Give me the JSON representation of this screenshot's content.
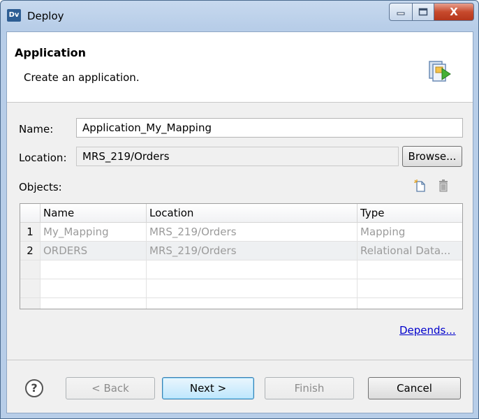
{
  "window": {
    "app_icon": "Dv",
    "title": "Deploy",
    "controls": {
      "minimize": "—",
      "maximize": "☐",
      "close": "X"
    }
  },
  "header": {
    "title": "Application",
    "subtitle": "Create an application.",
    "icon": "wizard-deploy-icon"
  },
  "form": {
    "name_label": "Name:",
    "name_value": "Application_My_Mapping",
    "location_label": "Location:",
    "location_value": "MRS_219/Orders",
    "browse_label": "Browse...",
    "objects_label": "Objects:",
    "add_icon": "new-object-icon",
    "delete_icon": "trash-icon"
  },
  "table": {
    "columns": [
      "Name",
      "Location",
      "Type"
    ],
    "rows": [
      {
        "num": "1",
        "name": "My_Mapping",
        "location": "MRS_219/Orders",
        "type": "Mapping"
      },
      {
        "num": "2",
        "name": "ORDERS",
        "location": "MRS_219/Orders",
        "type": "Relational  Data..."
      }
    ]
  },
  "depends_label": "Depends...",
  "footer": {
    "help": "?",
    "back": "< Back",
    "next": "Next >",
    "finish": "Finish",
    "cancel": "Cancel"
  }
}
